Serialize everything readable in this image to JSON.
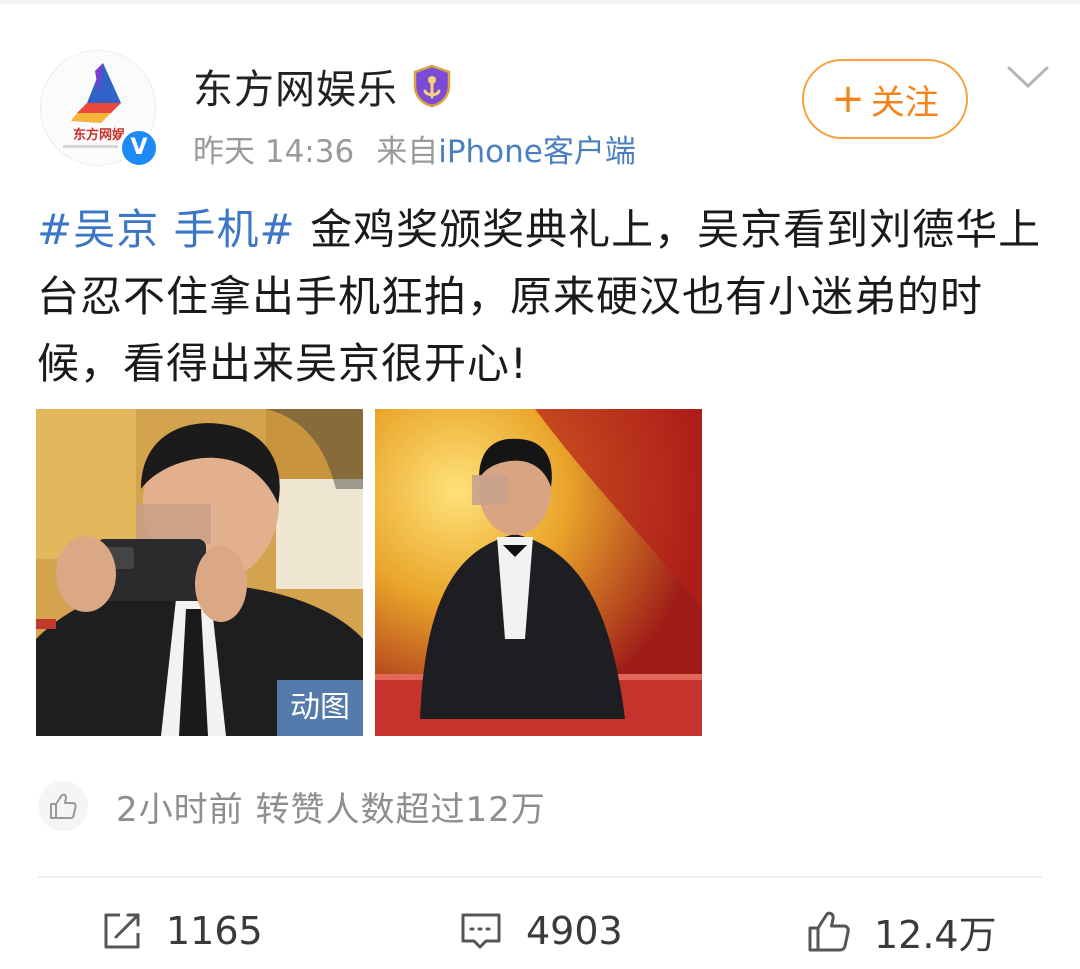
{
  "post": {
    "author": {
      "name": "东方网娱乐",
      "avatar_logo_text": "东方网娱",
      "verified_icon": "verified-blue-v-icon",
      "vip_icon": "vip-shield-badge-icon"
    },
    "meta": {
      "time": "昨天 14:36",
      "source_prefix": "来自",
      "source_link": "iPhone客户端"
    },
    "follow_button": {
      "plus": "+",
      "label": "关注"
    },
    "text": {
      "hashtag": "#吴京 手机#",
      "body": " 金鸡奖颁奖典礼上，吴京看到刘德华上台忍不住拿出手机狂拍，原来硬汉也有小迷弟的时候，看得出来吴京很开心!"
    },
    "images": [
      {
        "badge": "动图"
      },
      {
        "badge": ""
      }
    ],
    "like_summary": {
      "text": "2小时前 转赞人数超过12万"
    },
    "actions": {
      "repost_count": "1165",
      "comment_count": "4903",
      "like_count": "12.4万"
    }
  },
  "colors": {
    "accent_link": "#3b77c4",
    "follow_orange": "#f7831a",
    "verified_blue": "#1d8bf3"
  }
}
